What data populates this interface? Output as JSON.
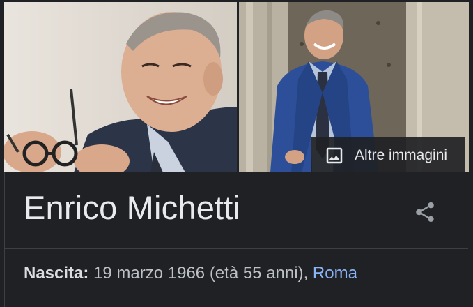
{
  "images": {
    "more_images_label": "Altre immagini",
    "more_images_icon": "image-icon"
  },
  "entity": {
    "name": "Enrico Michetti",
    "share_icon": "share-icon"
  },
  "facts": {
    "birth_label": "Nascita:",
    "birth_value": " 19 marzo 1966 (età 55 anni), ",
    "birth_place": "Roma"
  },
  "colors": {
    "background": "#202124",
    "text": "#e8eaed",
    "link": "#8ab4f8"
  }
}
